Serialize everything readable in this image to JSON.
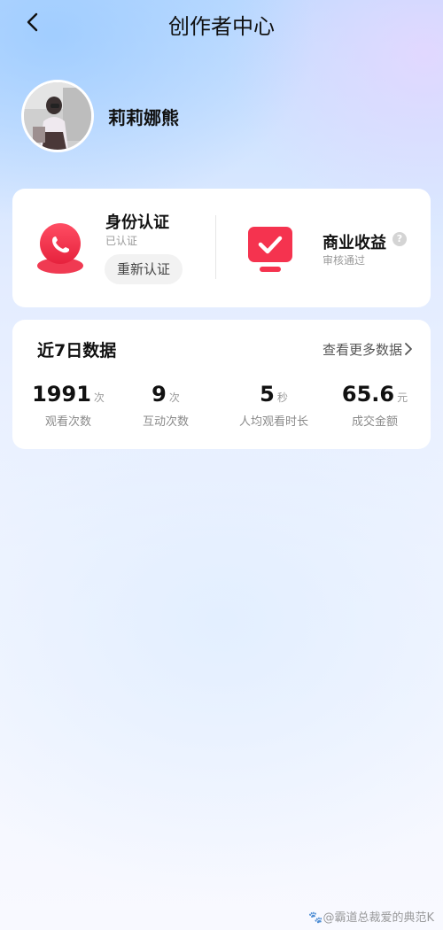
{
  "header": {
    "title": "创作者中心"
  },
  "profile": {
    "name": "莉莉娜熊"
  },
  "verification": {
    "identity": {
      "title": "身份认证",
      "status": "已认证",
      "button": "重新认证"
    },
    "business": {
      "title": "商业收益",
      "status": "审核通过",
      "help": "?"
    }
  },
  "stats": {
    "title": "近7日数据",
    "more_label": "查看更多数据",
    "items": [
      {
        "value": "1991",
        "unit": "次",
        "label": "观看次数"
      },
      {
        "value": "9",
        "unit": "次",
        "label": "互动次数"
      },
      {
        "value": "5",
        "unit": "秒",
        "label": "人均观看时长"
      },
      {
        "value": "65.6",
        "unit": "元",
        "label": "成交金额"
      }
    ]
  },
  "watermark": "🐾@霸道总裁爱的典范K",
  "colors": {
    "accent": "#f5334f",
    "card": "#ffffff",
    "muted": "#9a9a9a"
  }
}
